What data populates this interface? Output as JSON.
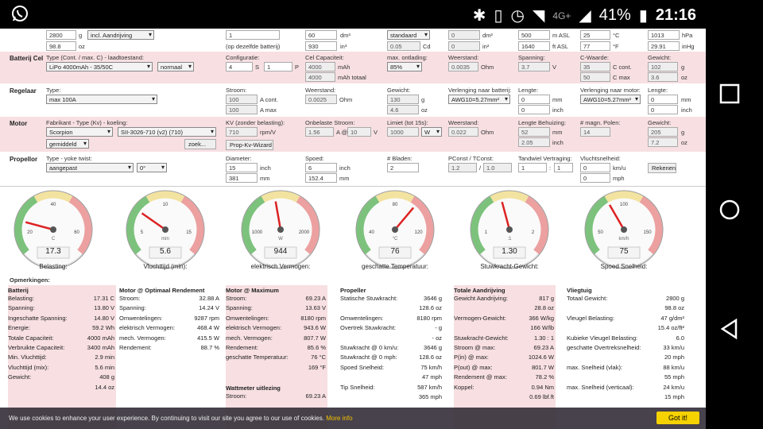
{
  "status": {
    "time": "21:16",
    "battery": "41%",
    "network": "4G+"
  },
  "mass": {
    "v1": "2800",
    "u1": "g",
    "sel": "incl. Aandrijving",
    "v2": "98.8",
    "u2": "oz",
    "alt1": "1",
    "alt2": "(op dezelfde batterij)",
    "vol1": "60",
    "volu1": "dm³",
    "vol2": "930",
    "volu2": "in³",
    "std": "standaard",
    "cd": "0.05",
    "cdu": "Cd",
    "wing1": "0",
    "wingu1": "dm²",
    "wing2": "0",
    "wingu2": "in²",
    "elev1": "500",
    "elevu1": "m ASL",
    "elev2": "1640",
    "elevu2": "ft ASL",
    "t1": "25",
    "tu1": "°C",
    "t2": "77",
    "tu2": "°F",
    "p1": "1013",
    "pu1": "hPa",
    "p2": "29.91",
    "pu2": "inHg"
  },
  "battery": {
    "title": "Batterij Cel",
    "type_label": "Type (Cont. / max. C) - laadtoestand:",
    "type": "LiPo 4000mAh - 35/50C",
    "charge": "normaal",
    "config_label": "Configuratie:",
    "s": "4",
    "su": "S",
    "p": "1",
    "pu": "P",
    "cap_label": "Cel Capaciteit:",
    "cap1": "4000",
    "capu1": "mAh",
    "cap2": "4000",
    "capu2": "mAh totaal",
    "disch_label": "max. ontlading:",
    "disch": "85%",
    "res_label": "Weerstand:",
    "res": "0.0035",
    "resu": "Ohm",
    "volt_label": "Spanning:",
    "volt": "3.7",
    "voltu": "V",
    "c_label": "C-Waarde:",
    "c1": "35",
    "cu1": "C cont.",
    "c2": "50",
    "cu2": "C max",
    "w_label": "Gewicht:",
    "w1": "102",
    "wu1": "g",
    "w2": "3.6",
    "wu2": "oz"
  },
  "esc": {
    "title": "Regelaar",
    "type_label": "Type:",
    "type": "max 100A",
    "cur_label": "Stroom:",
    "cur1": "100",
    "curu1": "A cont.",
    "cur2": "100",
    "curu2": "A max",
    "res_label": "Weerstand:",
    "res": "0.0025",
    "resu": "Ohm",
    "w_label": "Gewicht:",
    "w1": "130",
    "wu1": "g",
    "w2": "4.6",
    "wu2": "oz",
    "wire_label": "Verlenging naar batterij:",
    "wire": "AWG10=5.27mm²",
    "len_label": "Lengte:",
    "len1": "0",
    "lenu1": "mm",
    "len2": "0",
    "lenu2": "inch",
    "wire2_label": "Verlenging naar motor:",
    "wire2": "AWG10=5.27mm²",
    "len2_label": "Lengte:",
    "l2a": "0",
    "l2au": "mm",
    "l2b": "0",
    "l2bu": "inch"
  },
  "motor": {
    "title": "Motor",
    "type_label": "Fabrikant - Type (Kv) - koeling:",
    "maker": "Scorpion",
    "model": "SII-3026-710 (v2) (710)",
    "cool": "gemiddeld",
    "search": "zoek...",
    "kv_label": "KV (zonder belasting):",
    "kv": "710",
    "kvu": "rpm/V",
    "wiz": "Prop-Kv-Wizard",
    "i0_label": "Onbelaste Stroom:",
    "i0": "1.56",
    "i0u": "A @",
    "i0v": "10",
    "i0vu": "V",
    "lim_label": "Limiet (tot 15s):",
    "lim": "1000",
    "limu": "W",
    "res_label": "Weerstand:",
    "res": "0.022",
    "resu": "Ohm",
    "case_label": "Lengte Behuizing:",
    "case1": "52",
    "caseu1": "mm",
    "case2": "2.05",
    "caseu2": "inch",
    "poles_label": "# magn. Polen:",
    "poles": "14",
    "w_label": "Gewicht:",
    "w1": "205",
    "wu1": "g",
    "w2": "7.2",
    "wu2": "oz"
  },
  "prop": {
    "title": "Propellor",
    "type_label": "Type - yoke twist:",
    "type": "aangepast",
    "twist": "0°",
    "dia_label": "Diameter:",
    "dia1": "15",
    "diau1": "inch",
    "dia2": "381",
    "diau2": "mm",
    "pitch_label": "Spoed:",
    "pitch1": "6",
    "pitchu1": "inch",
    "pitch2": "152.4",
    "pitchu2": "mm",
    "blades_label": "# Bladen:",
    "blades": "2",
    "pc_label": "PConst / TConst:",
    "pc": "1.2",
    "tc": "1.0",
    "gear_label": "Tandwiel Vertraging:",
    "g1": "1",
    "g2": "1",
    "speed_label": "Vluchtsnelheid:",
    "sp1": "0",
    "spu1": "km/u",
    "sp2": "0",
    "spu2": "mph",
    "calc": "Rekenen"
  },
  "gauges": [
    {
      "name": "Belasting:",
      "value": "17.3",
      "unit": "C",
      "ticks": [
        "20",
        "40",
        "60"
      ],
      "angle": -75
    },
    {
      "name": "Vluchttijd (min):",
      "value": "5.6",
      "unit": "min",
      "ticks": [
        "5",
        "10",
        "15"
      ],
      "angle": -55
    },
    {
      "name": "elektrisch Vermogen:",
      "value": "944",
      "unit": "W",
      "ticks": [
        "1000",
        "2000"
      ],
      "angle": -10
    },
    {
      "name": "geschatte Temperatuur:",
      "value": "76",
      "unit": "°C",
      "ticks": [
        "40",
        "80",
        "120"
      ],
      "angle": 40
    },
    {
      "name": "Stuwkracht-Gewicht:",
      "value": "1.30",
      "unit": ":1",
      "ticks": [
        "1",
        "2"
      ],
      "angle": -15
    },
    {
      "name": "Spoed Snelheid:",
      "value": "75",
      "unit": "km/h",
      "ticks": [
        "50",
        "100",
        "150"
      ],
      "angle": -30
    }
  ],
  "remarks": "Opmerkingen:",
  "results": [
    {
      "title": "Batterij",
      "rows": [
        [
          "Belasting:",
          "17.31 C"
        ],
        [
          "Spanning:",
          "13.80 V"
        ],
        [
          "Ingeschatte Spanning:",
          "14.80 V"
        ],
        [
          "Energie:",
          "59.2 Wh"
        ],
        [
          "Totale Capaciteit:",
          "4000 mAh"
        ],
        [
          "Verbruikte Capaciteit:",
          "3400 mAh"
        ],
        [
          "Min. Vluchttijd:",
          "2.9 min"
        ],
        [
          "Vluchttijd (mix):",
          "5.6 min"
        ],
        [
          "Gewicht:",
          "408 g"
        ],
        [
          "",
          "14.4 oz"
        ]
      ]
    },
    {
      "title": "Motor @ Optimaal Rendement",
      "rows": [
        [
          "Stroom:",
          "32.88 A"
        ],
        [
          "Spanning:",
          "14.24 V"
        ],
        [
          "Omwentelingen:",
          "9287 rpm"
        ],
        [
          "elektrisch Vermogen:",
          "468.4 W"
        ],
        [
          "mech. Vermogen:",
          "415.5 W"
        ],
        [
          "Rendement:",
          "88.7 %"
        ]
      ]
    },
    {
      "title": "Motor @ Maximum",
      "rows": [
        [
          "Stroom:",
          "69.23 A"
        ],
        [
          "Spanning:",
          "13.63 V"
        ],
        [
          "Omwentelingen:",
          "8180 rpm"
        ],
        [
          "elektrisch Vermogen:",
          "943.6 W"
        ],
        [
          "mech. Vermogen:",
          "807.7 W"
        ],
        [
          "Rendement:",
          "85.6 %"
        ],
        [
          "geschatte Temperatuur:",
          "76 °C"
        ],
        [
          "",
          "169 °F"
        ]
      ],
      "extra_title": "Wattmeter uitlezing",
      "extra": [
        [
          "Stroom:",
          "69.23 A"
        ]
      ]
    },
    {
      "title": "Propeller",
      "rows": [
        [
          "Statische Stuwkracht:",
          "3646 g"
        ],
        [
          "",
          "128.6 oz"
        ],
        [
          "Omwentelingen:",
          "8180 rpm"
        ],
        [
          "Overtrek Stuwkracht:",
          "- g"
        ],
        [
          "",
          "- oz"
        ],
        [
          "Stuwkracht @ 0 km/u:",
          "3646 g"
        ],
        [
          "Stuwkracht @ 0 mph:",
          "128.6 oz"
        ],
        [
          "Spoed Snelheid:",
          "75 km/h"
        ],
        [
          "",
          "47 mph"
        ],
        [
          "Tip Snelheid:",
          "587 km/h"
        ],
        [
          "",
          "365 mph"
        ]
      ]
    },
    {
      "title": "Totale Aandrijving",
      "rows": [
        [
          "Gewicht Aandrijving:",
          "817 g"
        ],
        [
          "",
          "28.8 oz"
        ],
        [
          "Vermogen-Gewicht:",
          "366 W/kg"
        ],
        [
          "",
          "166 W/lb"
        ],
        [
          "Stuwkracht-Gewicht:",
          "1.30 : 1"
        ],
        [
          "Stroom @ max:",
          "69.23 A"
        ],
        [
          "P(in) @ max:",
          "1024.6 W"
        ],
        [
          "P(out) @ max:",
          "801.7 W"
        ],
        [
          "Rendement @ max:",
          "78.2 %"
        ],
        [
          "Koppel:",
          "0.94 Nm"
        ],
        [
          "",
          "0.69 lbf.ft"
        ]
      ]
    },
    {
      "title": "Vliegtuig",
      "rows": [
        [
          "Totaal Gewicht:",
          "2800 g"
        ],
        [
          "",
          "98.8 oz"
        ],
        [
          "Vleugel Belasting:",
          "47 g/dm²"
        ],
        [
          "",
          "15.4 oz/ft²"
        ],
        [
          "Kubieke Vleugel Belasting:",
          "6.0"
        ],
        [
          "geschatte Overtreksnelheid:",
          "33 km/u"
        ],
        [
          "",
          "20 mph"
        ],
        [
          "max. Snelheid (vlak):",
          "88 km/u"
        ],
        [
          "",
          "55 mph"
        ],
        [
          "max. Snelheid (verticaal):",
          "24 km/u"
        ],
        [
          "",
          "15 mph"
        ]
      ]
    }
  ],
  "cookie": {
    "msg": "We use cookies to enhance your user experience. By continuing to visit our site you agree to our use of cookies.",
    "more": "More info",
    "got": "Got it!"
  }
}
